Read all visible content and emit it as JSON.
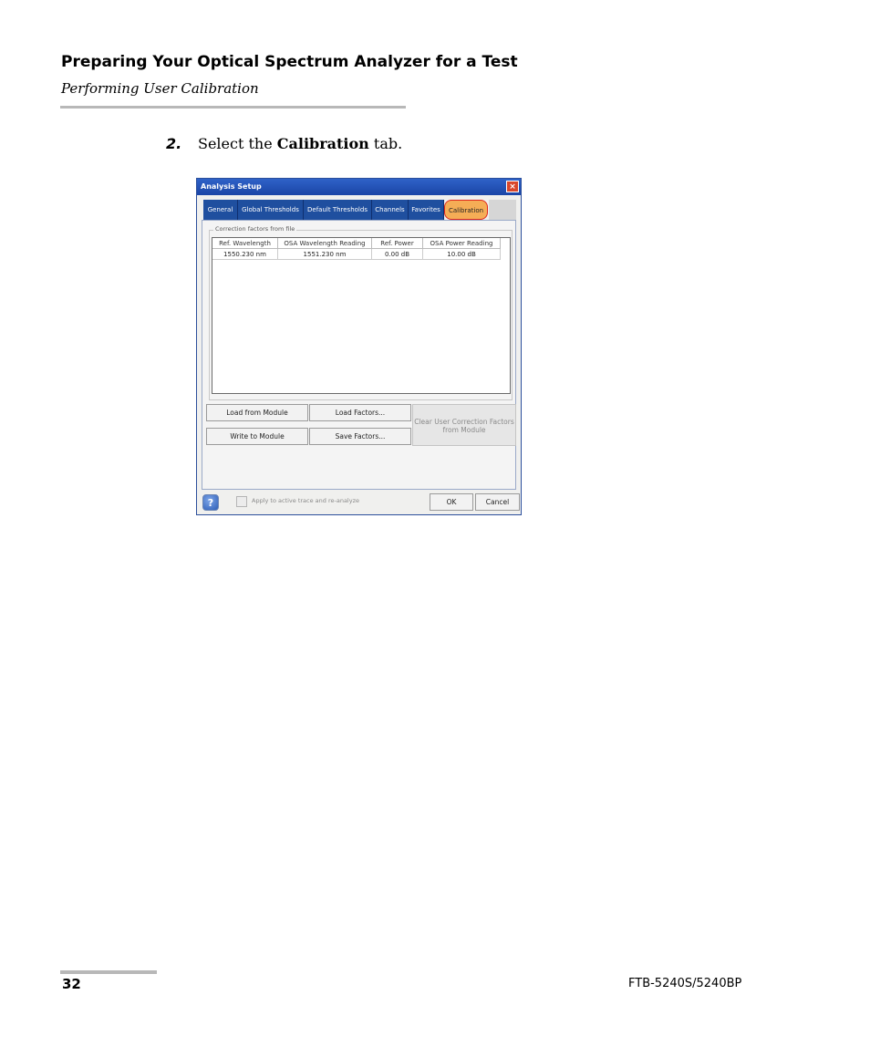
{
  "header": {
    "title": "Preparing Your Optical Spectrum Analyzer for a Test",
    "subtitle": "Performing User Calibration"
  },
  "step": {
    "number": "2.",
    "text_before": "Select the ",
    "bold": "Calibration",
    "text_after": " tab."
  },
  "dialog": {
    "title": "Analysis Setup",
    "close_glyph": "×",
    "tabs": [
      "General",
      "Global Thresholds",
      "Default Thresholds",
      "Channels",
      "Favorites",
      "Calibration"
    ],
    "active_tab": "Calibration",
    "group_label": "Correction factors from file",
    "table": {
      "columns": [
        "Ref. Wavelength",
        "OSA Wavelength Reading",
        "Ref. Power",
        "OSA Power Reading"
      ],
      "rows": [
        [
          "1550.230 nm",
          "1551.230 nm",
          "0.00 dB",
          "10.00 dB"
        ]
      ]
    },
    "buttons": {
      "load_from_module": "Load from Module",
      "load_factors": "Load Factors...",
      "clear_line1": "Clear User Correction Factors",
      "clear_line2": "from Module",
      "write_to_module": "Write to Module",
      "save_factors": "Save Factors...",
      "ok": "OK",
      "cancel": "Cancel",
      "help": "?"
    },
    "checkbox_label": "Apply to active trace and re-analyze"
  },
  "footer": {
    "page_number": "32",
    "doc_id": "FTB-5240S/5240BP"
  },
  "colors": {
    "tab_blue": "#1f4f9f",
    "active_tab_orange": "#f5ad56",
    "highlight_red": "#e0261c"
  }
}
